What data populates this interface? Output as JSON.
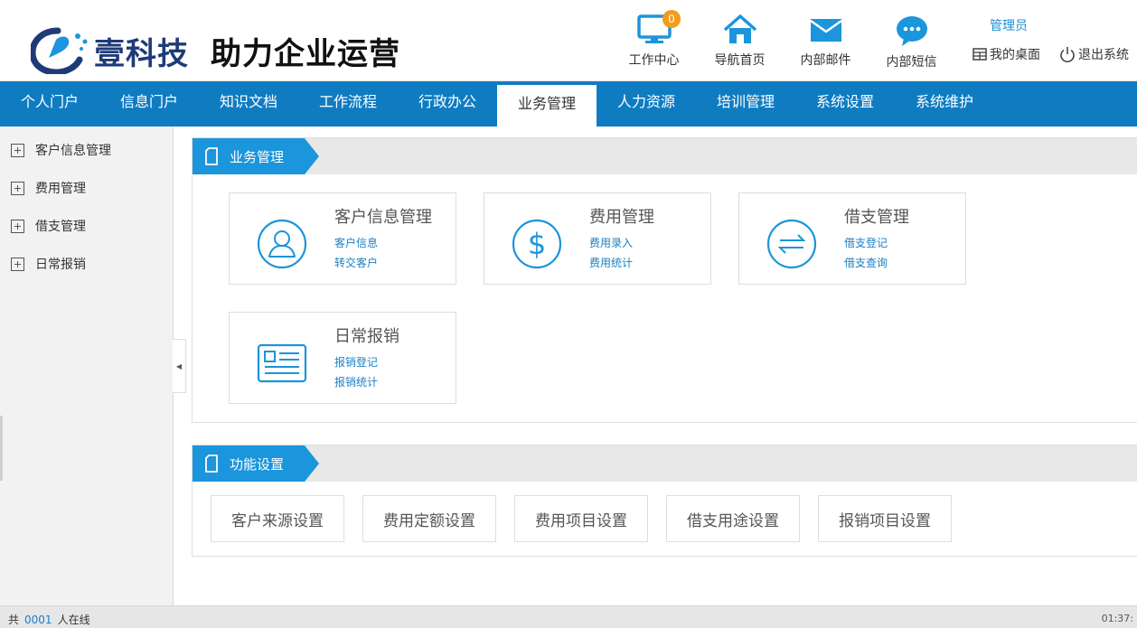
{
  "header": {
    "brand": "壹科技",
    "slogan": "助力企业运营",
    "top_icons": [
      {
        "label": "工作中心",
        "icon": "monitor-icon",
        "badge": "0"
      },
      {
        "label": "导航首页",
        "icon": "home-icon"
      },
      {
        "label": "内部邮件",
        "icon": "mail-icon"
      },
      {
        "label": "内部短信",
        "icon": "chat-icon"
      }
    ],
    "user": "管理员",
    "my_desktop": "我的桌面",
    "logout": "退出系统"
  },
  "nav": {
    "items": [
      "个人门户",
      "信息门户",
      "知识文档",
      "工作流程",
      "行政办公",
      "业务管理",
      "人力资源",
      "培训管理",
      "系统设置",
      "系统维护"
    ],
    "active": "业务管理"
  },
  "sidebar": {
    "items": [
      {
        "label": "客户信息管理"
      },
      {
        "label": "费用管理"
      },
      {
        "label": "借支管理"
      },
      {
        "label": "日常报销"
      }
    ],
    "collapse_glyph": "◀"
  },
  "business_panel": {
    "title": "业务管理",
    "cards": [
      {
        "title": "客户信息管理",
        "links": [
          "客户信息",
          "转交客户"
        ],
        "icon": "user-icon"
      },
      {
        "title": "费用管理",
        "links": [
          "费用录入",
          "费用统计"
        ],
        "icon": "dollar-icon"
      },
      {
        "title": "借支管理",
        "links": [
          "借支登记",
          "借支查询"
        ],
        "icon": "exchange-icon"
      },
      {
        "title": "日常报销",
        "links": [
          "报销登记",
          "报销统计"
        ],
        "icon": "id-card-icon"
      }
    ]
  },
  "settings_panel": {
    "title": "功能设置",
    "buttons": [
      "客户来源设置",
      "费用定额设置",
      "费用项目设置",
      "借支用途设置",
      "报销项目设置"
    ]
  },
  "footer": {
    "prefix": "共",
    "online_count": "0001",
    "suffix": "人在线",
    "time": "01:37:"
  },
  "colors": {
    "nav_bg": "#0f7cc2",
    "accent": "#1b95db",
    "link": "#1a7fc6",
    "badge": "#f59c1a"
  }
}
